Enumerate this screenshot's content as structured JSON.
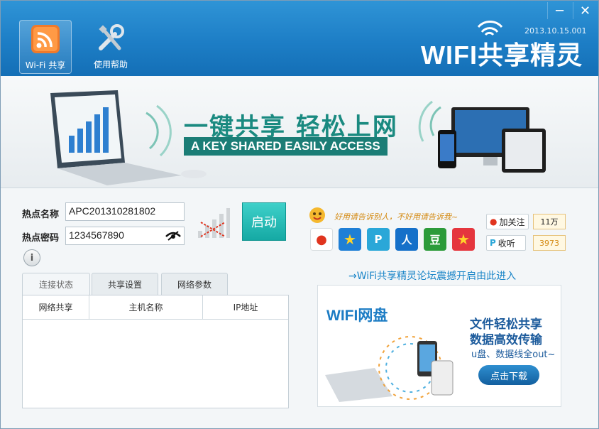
{
  "window": {
    "minimize_icon": "minimize-icon",
    "close_icon": "close-icon"
  },
  "toolbar": {
    "wifi_share_label": "Wi-Fi 共享",
    "help_label": "使用帮助"
  },
  "brand": {
    "version": "2013.10.15.001",
    "logo_text": "WIFI共享精灵"
  },
  "banner": {
    "title": "一键共享 轻松上网",
    "subtitle": "A KEY SHARED EASILY ACCESS"
  },
  "form": {
    "ssid_label": "热点名称",
    "ssid_value": "APC201310281802",
    "password_label": "热点密码",
    "password_value": "1234567890",
    "start_label": "启动"
  },
  "tabs": [
    {
      "label": "连接状态"
    },
    {
      "label": "共享设置"
    },
    {
      "label": "网络参数"
    }
  ],
  "table": {
    "columns": [
      "网络共享",
      "主机名称",
      "IP地址"
    ]
  },
  "social": {
    "slogan": "好用请告诉别人，不好用请告诉我~",
    "weibo_follow": "加关注",
    "weibo_count": "11万",
    "listen_label": "收听",
    "listen_count": "3973"
  },
  "forum": {
    "link_text": "→WiFi共享精灵论坛震撼开启由此进入"
  },
  "ad": {
    "brand": "WIFI网盘",
    "line1": "文件轻松共享",
    "line2": "数据高效传输",
    "line3": "u盘、数据线全out~",
    "download_label": "点击下载"
  },
  "colors": {
    "header": "#1d7ec6",
    "accent": "#15a9a4",
    "banner_text": "#1a8a80",
    "link": "#1c86c8"
  }
}
